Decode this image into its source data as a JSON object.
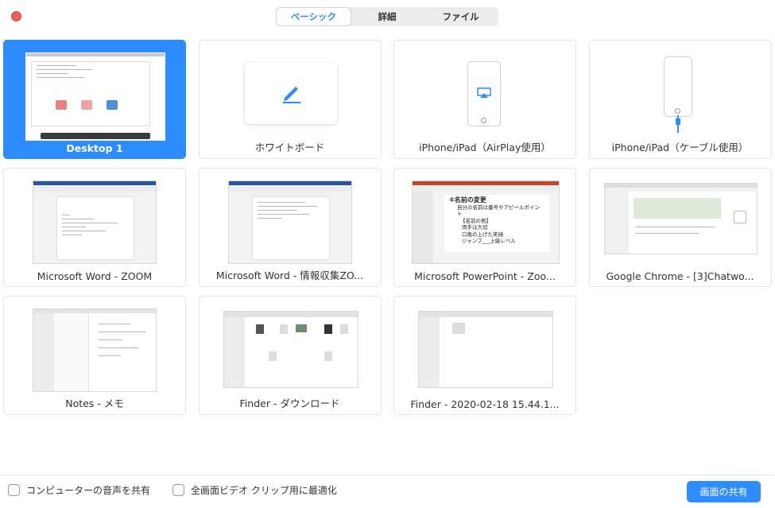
{
  "tabs": [
    {
      "label": "ベーシック",
      "active": true
    },
    {
      "label": "詳細",
      "active": false
    },
    {
      "label": "ファイル",
      "active": false
    }
  ],
  "tiles": [
    {
      "label": "Desktop 1",
      "selected": true
    },
    {
      "label": "ホワイトボード"
    },
    {
      "label": "iPhone/iPad（AirPlay使用）"
    },
    {
      "label": "iPhone/iPad（ケーブル使用）"
    },
    {
      "label": "Microsoft Word - ZOOM"
    },
    {
      "label": "Microsoft Word - 情報収集ZO..."
    },
    {
      "label": "Microsoft PowerPoint - Zoo..."
    },
    {
      "label": "Google Chrome - [3]Chatwo..."
    },
    {
      "label": "Notes - メモ"
    },
    {
      "label": "Finder - ダウンロード"
    },
    {
      "label": "Finder - 2020-02-18 15.44.1..."
    }
  ],
  "ppt_slide": {
    "title": "⑤名前の変更",
    "lines": [
      "自分の名前は番号やアピールポイント",
      "【名前の例】",
      "両手は大切",
      "口角の上げた笑顔",
      "ジャンプ___上級レベル"
    ]
  },
  "footer": {
    "share_audio": "コンピューターの音声を共有",
    "optimize_video": "全画面ビデオ クリップ用に最適化",
    "share_button": "画面の共有"
  },
  "colors": {
    "accent": "#2d8cff",
    "close": "#ec5f57"
  }
}
